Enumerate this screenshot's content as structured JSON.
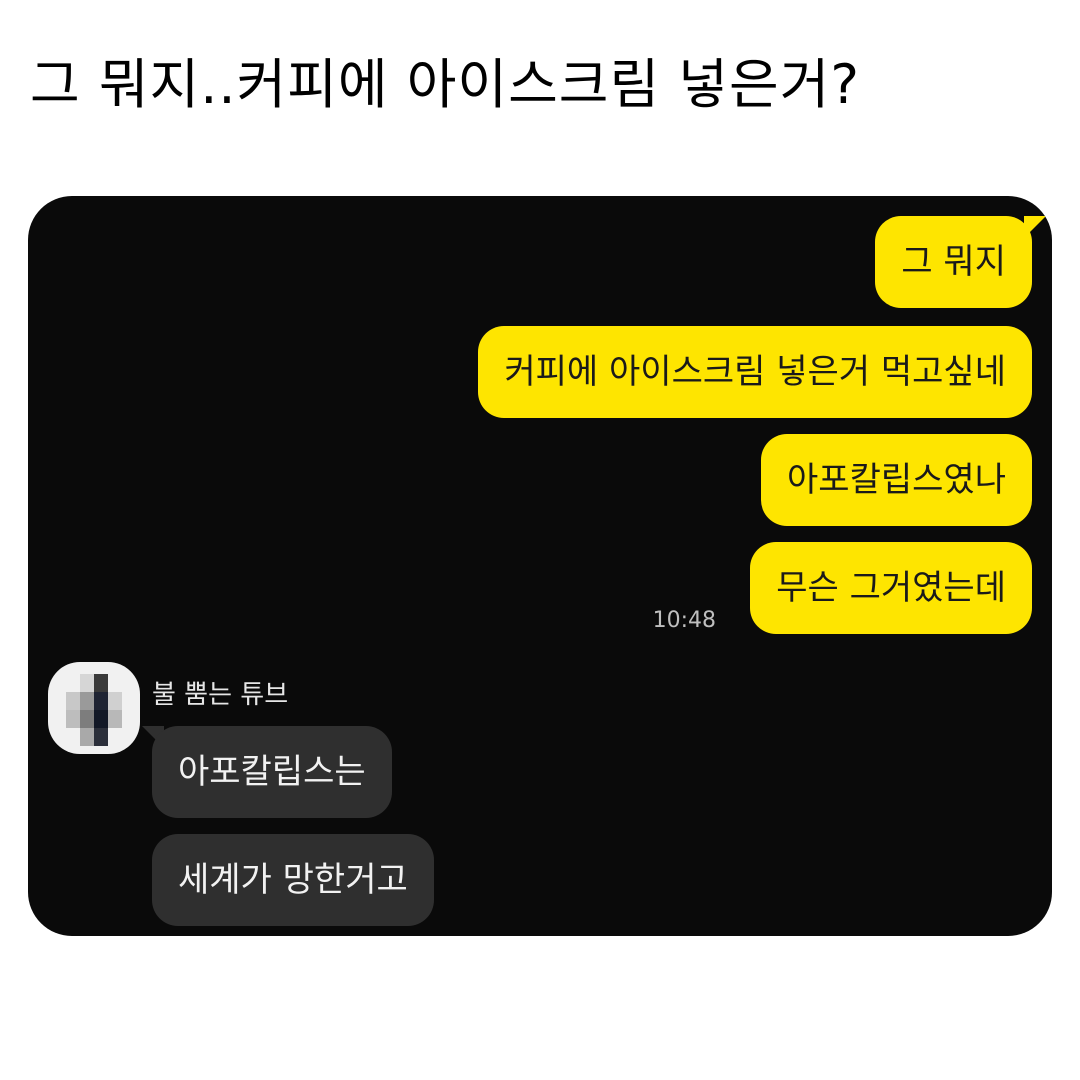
{
  "post": {
    "title": "그 뭐지..커피에 아이스크림 넣은거?"
  },
  "chat": {
    "sent_messages": [
      "그 뭐지",
      "커피에 아이스크림 넣은거 먹고싶네",
      "아포칼립스였나",
      "무슨 그거였는데"
    ],
    "sent_time": "10:48",
    "sender": {
      "name": "불 뿜는 튜브",
      "avatar": "blurred-avatar"
    },
    "received_messages": [
      "아포칼립스는",
      "세계가 망한거고"
    ]
  },
  "colors": {
    "sent_bubble": "#fee500",
    "received_bubble": "#2f2f2f",
    "chat_background": "#0a0a0a"
  }
}
